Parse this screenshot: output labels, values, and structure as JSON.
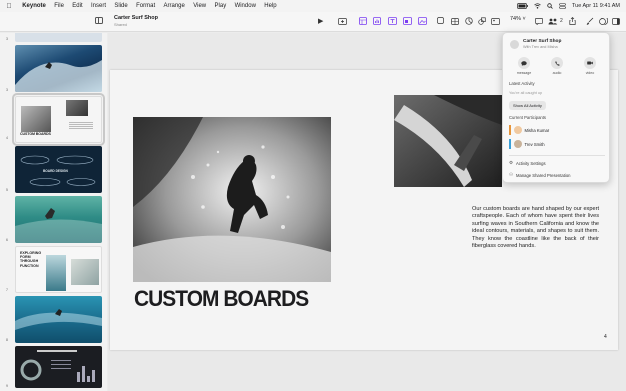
{
  "menubar": {
    "app_name": "Keynote",
    "items": [
      "File",
      "Edit",
      "Insert",
      "Slide",
      "Format",
      "Arrange",
      "View",
      "Play",
      "Window",
      "Help"
    ],
    "clock": "Tue Apr 11  9:41 AM"
  },
  "toolbar": {
    "doc_title": "Carter Surf Shop",
    "doc_subtitle": "Shared",
    "zoom": "74%"
  },
  "slide": {
    "heading": "CUSTOM BOARDS",
    "body": "Our custom boards are hand shaped by our expert craftspeople. Each of whom have spent their lives surfing waves in Southern California and know the ideal contours, materials, and shapes to suit them. They know the coastline like the back of their fiberglass covered hands.",
    "page_number": "4"
  },
  "navigator": {
    "slides": [
      {
        "number": "3",
        "theme": "wave-blue"
      },
      {
        "number": "4",
        "theme": "custom-boards"
      },
      {
        "number": "5",
        "theme": "board-design"
      },
      {
        "number": "6",
        "theme": "surfer-green"
      },
      {
        "number": "7",
        "theme": "exploring-form"
      },
      {
        "number": "8",
        "theme": "surfer-teal"
      },
      {
        "number": "9",
        "theme": "data"
      }
    ],
    "thumb_board_title": "BOARD DESIGN",
    "thumb_custom_title": "CUSTOM BOARDS",
    "thumb_explore_title": "EXPLORING FORM THROUGH FUNCTION"
  },
  "collab": {
    "title": "Carter Surf Shop",
    "subtitle": "With Trev and Misha",
    "actions": [
      "message",
      "audio",
      "video"
    ],
    "latest_activity_label": "Latest Activity",
    "caught_up": "You're all caught up",
    "show_all": "Show All Activity",
    "participants_label": "Current Participants",
    "participants": [
      {
        "name": "Misha Kumar",
        "color": "#e6953b"
      },
      {
        "name": "Trev Smith",
        "color": "#3aa0d8"
      }
    ],
    "activity_settings": "Activity Settings",
    "manage": "Manage Shared Presentation"
  }
}
